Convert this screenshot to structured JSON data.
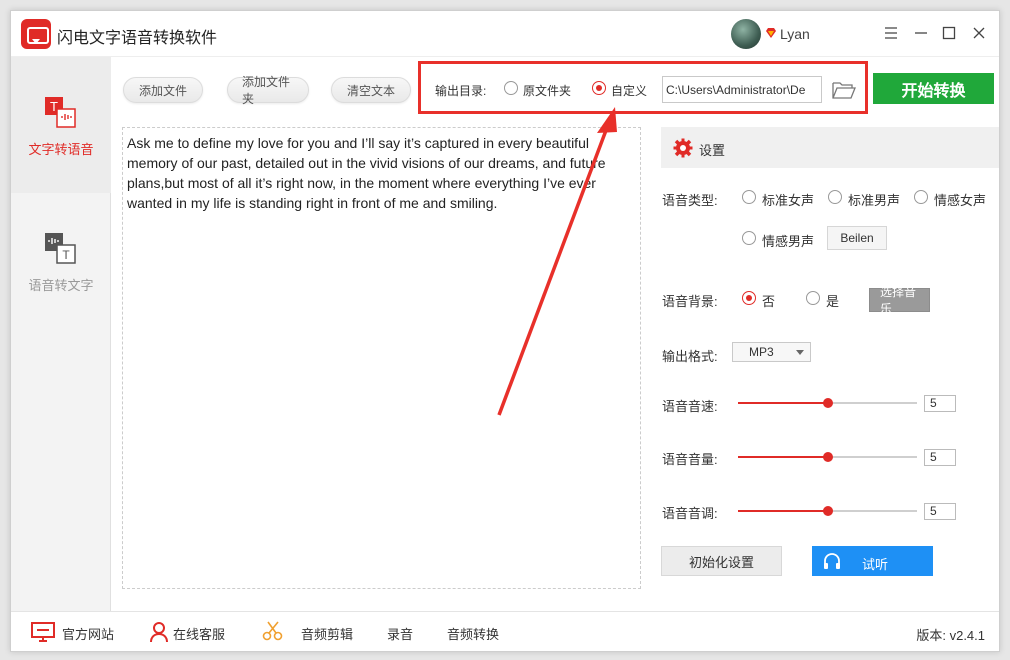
{
  "window": {
    "title": "闪电文字语音转换软件"
  },
  "user": {
    "name": "Lyan"
  },
  "sidebar": {
    "items": [
      {
        "label": "文字转语音",
        "active": true
      },
      {
        "label": "语音转文字",
        "active": false
      }
    ]
  },
  "toolbar": {
    "add_file": "添加文件",
    "add_folder": "添加文件夹",
    "clear_text": "清空文本",
    "output_dir_label": "输出目录:",
    "option_original": "原文件夹",
    "option_custom": "自定义",
    "selected_option": "自定义",
    "path_value": "C:\\Users\\Administrator\\De",
    "start_label": "开始转换"
  },
  "text_content": "Ask me to define my love for you and I’ll say it’s captured in every beautiful memory of our past, detailed out in the vivid visions of our dreams, and future plans,but most of all it’s right now, in the moment where everything I’ve ever wanted in my life is standing right in front of me and smiling.",
  "settings": {
    "title": "设置",
    "voice_type_label": "语音类型:",
    "voice_options": [
      "标准女声",
      "标准男声",
      "情感女声",
      "情感男声"
    ],
    "voice_extra_button": "Beilen",
    "bg_label": "语音背景:",
    "bg_no": "否",
    "bg_yes": "是",
    "bg_selected": "否",
    "choose_music": "选择音乐",
    "format_label": "输出格式:",
    "format_value": "MP3",
    "speed_label": "语音音速:",
    "speed_value": "5",
    "volume_label": "语音音量:",
    "volume_value": "5",
    "pitch_label": "语音音调:",
    "pitch_value": "5",
    "slider_level": 0.5,
    "reset_button": "初始化设置",
    "listen_button": "试听"
  },
  "bottom": {
    "official_site": "官方网站",
    "online_service": "在线客服",
    "audio_edit": "音频剪辑",
    "record": "录音",
    "audio_convert": "音频转换",
    "version_label": "版本: v2.4.1"
  },
  "colors": {
    "accent_red": "#e02b27",
    "start_green": "#20a83a",
    "listen_blue": "#1e90f5",
    "annotation_red": "#e8302a"
  }
}
